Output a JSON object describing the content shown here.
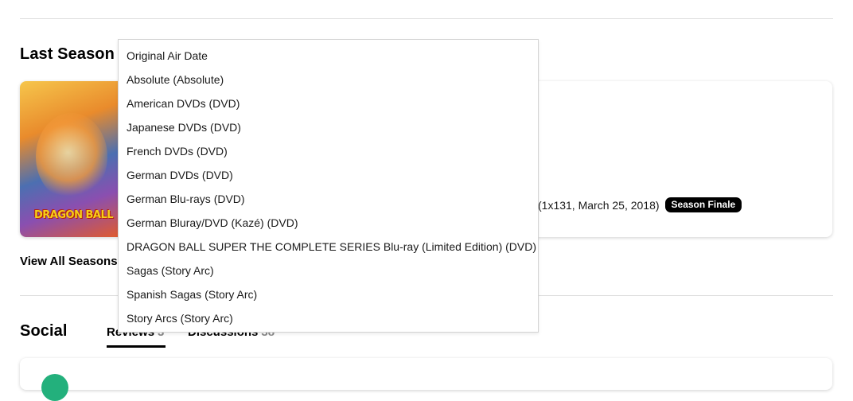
{
  "last_season": {
    "title": "Last Season",
    "poster": {
      "logo_text": "DRAGON BALL"
    },
    "episode_info": "(1x131, March 25, 2018)",
    "badge": "Season Finale",
    "view_all": "View All Seasons"
  },
  "social": {
    "title": "Social",
    "tabs": [
      {
        "label": "Reviews",
        "count": "3"
      },
      {
        "label": "Discussions",
        "count": "38"
      }
    ]
  },
  "order_dropdown": {
    "options": [
      "Original Air Date",
      "Absolute (Absolute)",
      "American DVDs (DVD)",
      "Japanese DVDs (DVD)",
      "French DVDs (DVD)",
      "German DVDs (DVD)",
      "German Blu-rays (DVD)",
      "German Bluray/DVD (Kazé) (DVD)",
      "DRAGON BALL SUPER THE COMPLETE SERIES Blu-ray (Limited Edition) (DVD)",
      "Sagas (Story Arc)",
      "Spanish Sagas (Story Arc)",
      "Story Arcs (Story Arc)"
    ]
  }
}
